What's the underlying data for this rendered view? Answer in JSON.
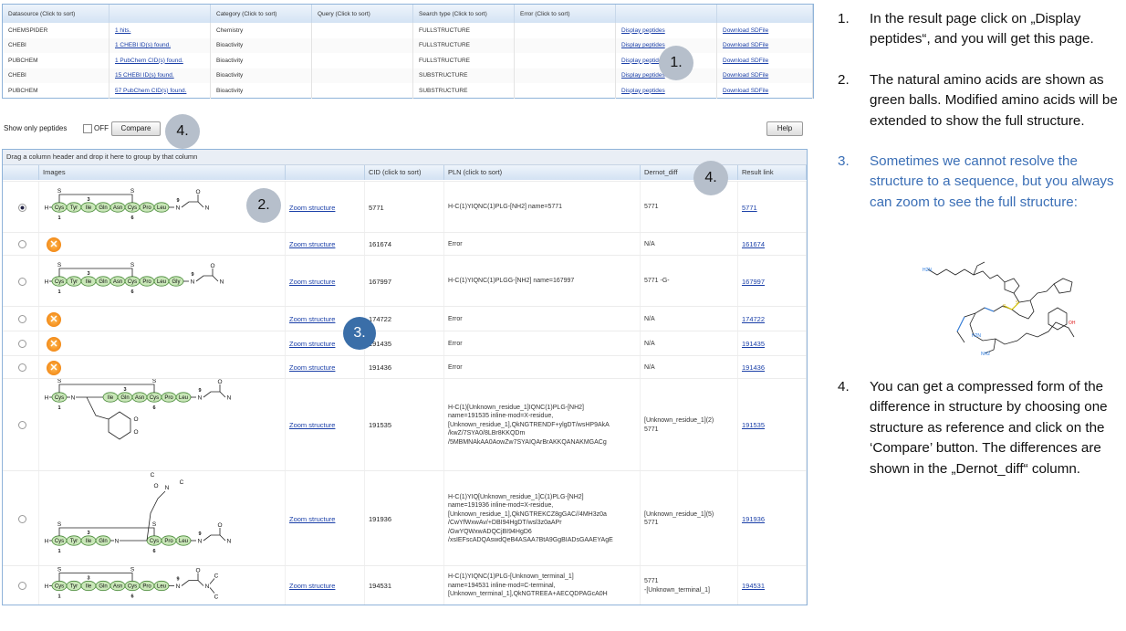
{
  "datasource_table": {
    "headers": [
      "Datasource (Click to sort)",
      "",
      "Category (Click to sort)",
      "Query (Click to sort)",
      "Search type (Click to sort)",
      "Error (Click to sort)",
      "",
      ""
    ],
    "rows": [
      {
        "source": "CHEMSPIDER",
        "hits": "1 hits.",
        "category": "Chemistry",
        "query": "",
        "search_type": "FULLSTRUCTURE",
        "error": "",
        "display": "Display peptides",
        "download": "Download SDFile"
      },
      {
        "source": "CHEBI",
        "hits": "1 CHEBI ID(s) found.",
        "category": "Bioactivity",
        "query": "",
        "search_type": "FULLSTRUCTURE",
        "error": "",
        "display": "Display peptides",
        "download": "Download SDFile"
      },
      {
        "source": "PUBCHEM",
        "hits": "1 PubChem CID(s) found.",
        "category": "Bioactivity",
        "query": "",
        "search_type": "FULLSTRUCTURE",
        "error": "",
        "display": "Display peptides",
        "download": "Download SDFile"
      },
      {
        "source": "CHEBI",
        "hits": "15 CHEBI ID(s) found.",
        "category": "Bioactivity",
        "query": "",
        "search_type": "SUBSTRUCTURE",
        "error": "",
        "display": "Display peptides",
        "download": "Download SDFile"
      },
      {
        "source": "PUBCHEM",
        "hits": "57 PubChem CID(s) found.",
        "category": "Bioactivity",
        "query": "",
        "search_type": "SUBSTRUCTURE",
        "error": "",
        "display": "Display peptides",
        "download": "Download SDFile"
      }
    ]
  },
  "toolbar": {
    "show_only_label": "Show only peptides",
    "toggle_state": "OFF",
    "compare_label": "Compare",
    "help_label": "Help"
  },
  "grid": {
    "group_hint": "Drag a column header and drop it here to group by that column",
    "headers": {
      "images": "Images",
      "cid": "CID (click to sort)",
      "pln": "PLN (click to sort)",
      "dernot": "Dernot_diff",
      "result": "Result link"
    },
    "zoom_label": "Zoom structure",
    "rows": [
      {
        "selected": true,
        "structure": "chain1",
        "cid": "5771",
        "pln": "H-C(1)YIQNC(1)PLG-[NH2] name=5771",
        "dernot": "5771",
        "link": "5771"
      },
      {
        "selected": false,
        "structure": "error",
        "cid": "161674",
        "pln": "Error",
        "dernot": "N/A",
        "link": "161674"
      },
      {
        "selected": false,
        "structure": "chain2",
        "cid": "167997",
        "pln": "H-C(1)YIQNC(1)PLGG-[NH2] name=167997",
        "dernot": "5771 -G-",
        "link": "167997"
      },
      {
        "selected": false,
        "structure": "error",
        "cid": "174722",
        "pln": "Error",
        "dernot": "N/A",
        "link": "174722"
      },
      {
        "selected": false,
        "structure": "error",
        "cid": "191435",
        "pln": "Error",
        "dernot": "N/A",
        "link": "191435"
      },
      {
        "selected": false,
        "structure": "error",
        "cid": "191436",
        "pln": "Error",
        "dernot": "N/A",
        "link": "191436"
      },
      {
        "selected": false,
        "structure": "chain3",
        "cid": "191535",
        "pln": "H-C(1)[Unknown_residue_1]IQNC(1)PLG-[NH2]\nname=191535 inline-mod=X-residue,\n[Unknown_residue_1],QkNGTRENDF+ylgDT/wsHP9AkA\n/kwZ/7SYA0/8LBr8KKQDm\n/5MBMNAkAA0AowZw7SYAIQArBrAKKQANAKMGACg",
        "dernot": "[Unknown_residue_1](2)\n5771",
        "link": "191535"
      },
      {
        "selected": false,
        "structure": "chain4",
        "cid": "191936",
        "pln": "H-C(1)YIQ[Unknown_residue_1]C(1)PLG-[NH2]\nname=191936 inline-mod=X-residue,\n[Unknown_residue_1],QkNGTREKCZ8gGAC//4MH3z0a\n/CwYfWxwAv/+DBI94HgDT/wsl3z0aAPr\n/GwYQWxwADQCjBI94HgD6\n/xsIEFscADQAswdQeB4ASAA7BtA9GgBIADsGAAEYAgE",
        "dernot": "[Unknown_residue_1](5)\n5771",
        "link": "191936"
      },
      {
        "selected": false,
        "structure": "chain5",
        "cid": "194531",
        "pln": "H-C(1)YIQNC(1)PLG-[Unknown_terminal_1]\nname=194531 inline-mod=C-terminal,\n[Unknown_terminal_1],QkNGTREEA+AECQDPAGcA0H",
        "dernot": "5771\n-[Unknown_terminal_1]",
        "link": "194531"
      }
    ]
  },
  "callouts": [
    "1.",
    "2.",
    "3.",
    "4.",
    "4."
  ],
  "instructions": [
    {
      "num": "1.",
      "text": "In the result page click on „Display peptides“, and you will get this page."
    },
    {
      "num": "2.",
      "text": "The natural amino acids are shown as green balls. Modified amino acids will be extended to show the full structure."
    },
    {
      "num": "3.",
      "text": "Sometimes we cannot resolve the structure to a sequence, but you always can zoom to see the full structure:"
    },
    {
      "num": "4.",
      "text": "You can get a compressed form of the difference in structure by choosing one structure as reference and click on the ‘Compare’ button. The differences are shown in the „Dernot_diff“ column."
    }
  ],
  "structure_atom_labels": {
    "H": "H",
    "N": "N",
    "S": "S",
    "num1": "1",
    "num3": "3",
    "num6": "6",
    "num9": "9",
    "O": "O",
    "C": "C",
    "H2N": "H2N",
    "OH": "OH",
    "NH2": "NH2"
  },
  "residues": {
    "chain1": [
      "Cys",
      "Tyr",
      "Ile",
      "Gln",
      "Asn",
      "Cys",
      "Pro",
      "Leu"
    ],
    "chain2": [
      "Cys",
      "Tyr",
      "Ile",
      "Gln",
      "Asn",
      "Cys",
      "Pro",
      "Leu",
      "Gly"
    ],
    "chain3": [
      "Cys",
      "Ile",
      "Gln",
      "Asn",
      "Cys",
      "Pro",
      "Leu"
    ],
    "chain4": [
      "Cys",
      "Tyr",
      "Ile",
      "Gln",
      "Cys",
      "Pro",
      "Leu"
    ],
    "chain5": [
      "Cys",
      "Tyr",
      "Ile",
      "Gln",
      "Asn",
      "Cys",
      "Pro",
      "Leu"
    ]
  },
  "colors": {
    "accent": "#3b6fb6",
    "grid_border": "#8fb3d9",
    "residue_fill": "#c9e7b8",
    "residue_stroke": "#4a8a3a",
    "error_orange": "#ee7700",
    "badge_gray": "#b6bfcb",
    "badge_blue": "#3a6ea8"
  }
}
